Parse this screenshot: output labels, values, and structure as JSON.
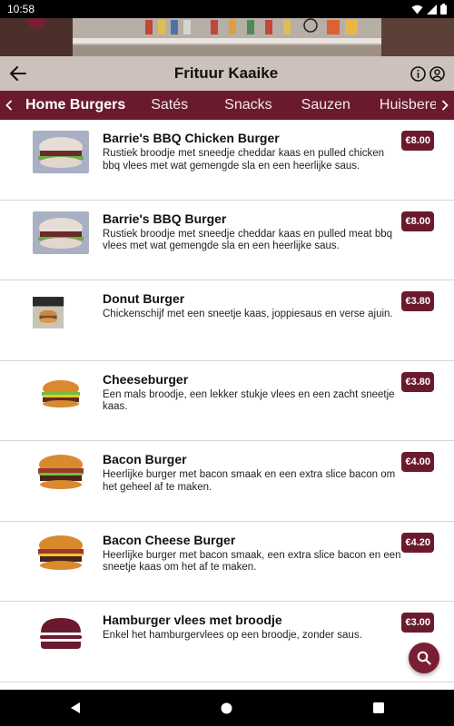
{
  "status": {
    "time": "10:58"
  },
  "header": {
    "title": "Frituur Kaaike"
  },
  "categories": {
    "tabs": [
      "Home Burgers",
      "Satés",
      "Snacks",
      "Sauzen",
      "Huisbereid"
    ],
    "active_index": 0
  },
  "items": [
    {
      "name": "Barrie's BBQ Chicken Burger",
      "description": "Rustiek broodje met sneedje cheddar kaas en pulled chicken bbq vlees met wat gemengde sla en een heerlijke saus.",
      "price": "€8.00",
      "icon": "bbq-burger-photo"
    },
    {
      "name": "Barrie's BBQ Burger",
      "description": "Rustiek broodje met sneedje cheddar kaas en pulled meat bbq vlees met wat gemengde sla en een heerlijke saus.",
      "price": "€8.00",
      "icon": "bbq-burger-photo"
    },
    {
      "name": "Donut Burger",
      "description": "Chickenschijf met een sneetje kaas, joppiesaus en verse ajuin.",
      "price": "€3.80",
      "icon": "donut-burger-photo"
    },
    {
      "name": "Cheeseburger",
      "description": "Een mals broodje, een lekker stukje vlees en een zacht sneetje kaas.",
      "price": "€3.80",
      "icon": "cheeseburger-photo"
    },
    {
      "name": "Bacon Burger",
      "description": "Heerlijke burger met bacon smaak en een extra slice bacon om het geheel af te maken.",
      "price": "€4.00",
      "icon": "bacon-burger-photo"
    },
    {
      "name": "Bacon Cheese Burger",
      "description": "Heerlijke burger met bacon smaak, een extra slice bacon en een sneetje kaas om het af te maken.",
      "price": "€4.20",
      "icon": "bacon-cheese-burger-photo"
    },
    {
      "name": "Hamburger vlees met broodje",
      "description": "Enkel het hamburgervlees op een broodje, zonder saus.",
      "price": "€3.00",
      "icon": "burger-icon"
    }
  ],
  "colors": {
    "brand": "#6b1a2e",
    "divider": "#d6d6d6"
  }
}
